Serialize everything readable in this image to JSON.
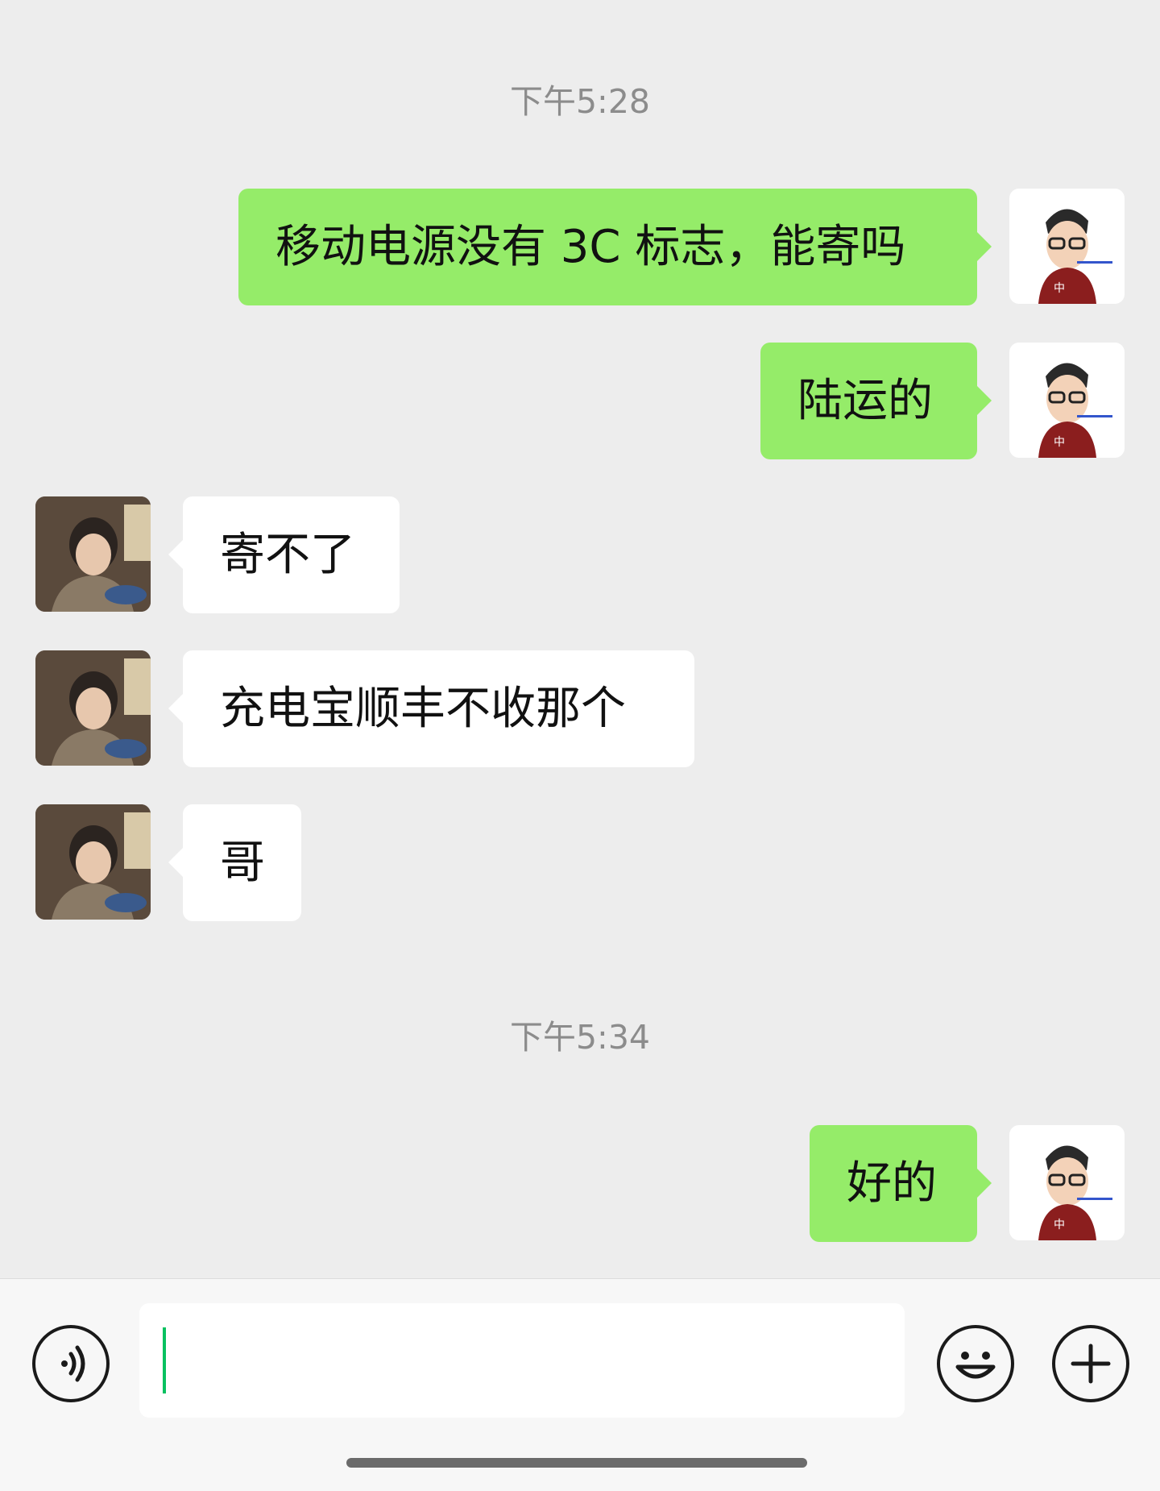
{
  "messages": {
    "time1": "下午5:28",
    "m1": "移动电源没有 3C 标志，能寄吗",
    "m2": "陆运的",
    "m3": "寄不了",
    "m4": "充电宝顺丰不收那个",
    "m5": "哥",
    "time2": "下午5:34",
    "m6": "好的"
  },
  "input": {
    "value": ""
  },
  "icons": {
    "voice": "voice-icon",
    "emoji": "emoji-icon",
    "plus": "plus-icon"
  },
  "colors": {
    "sent_bubble": "#95ec69",
    "received_bubble": "#ffffff",
    "background": "#ededed",
    "caret": "#07c160"
  }
}
